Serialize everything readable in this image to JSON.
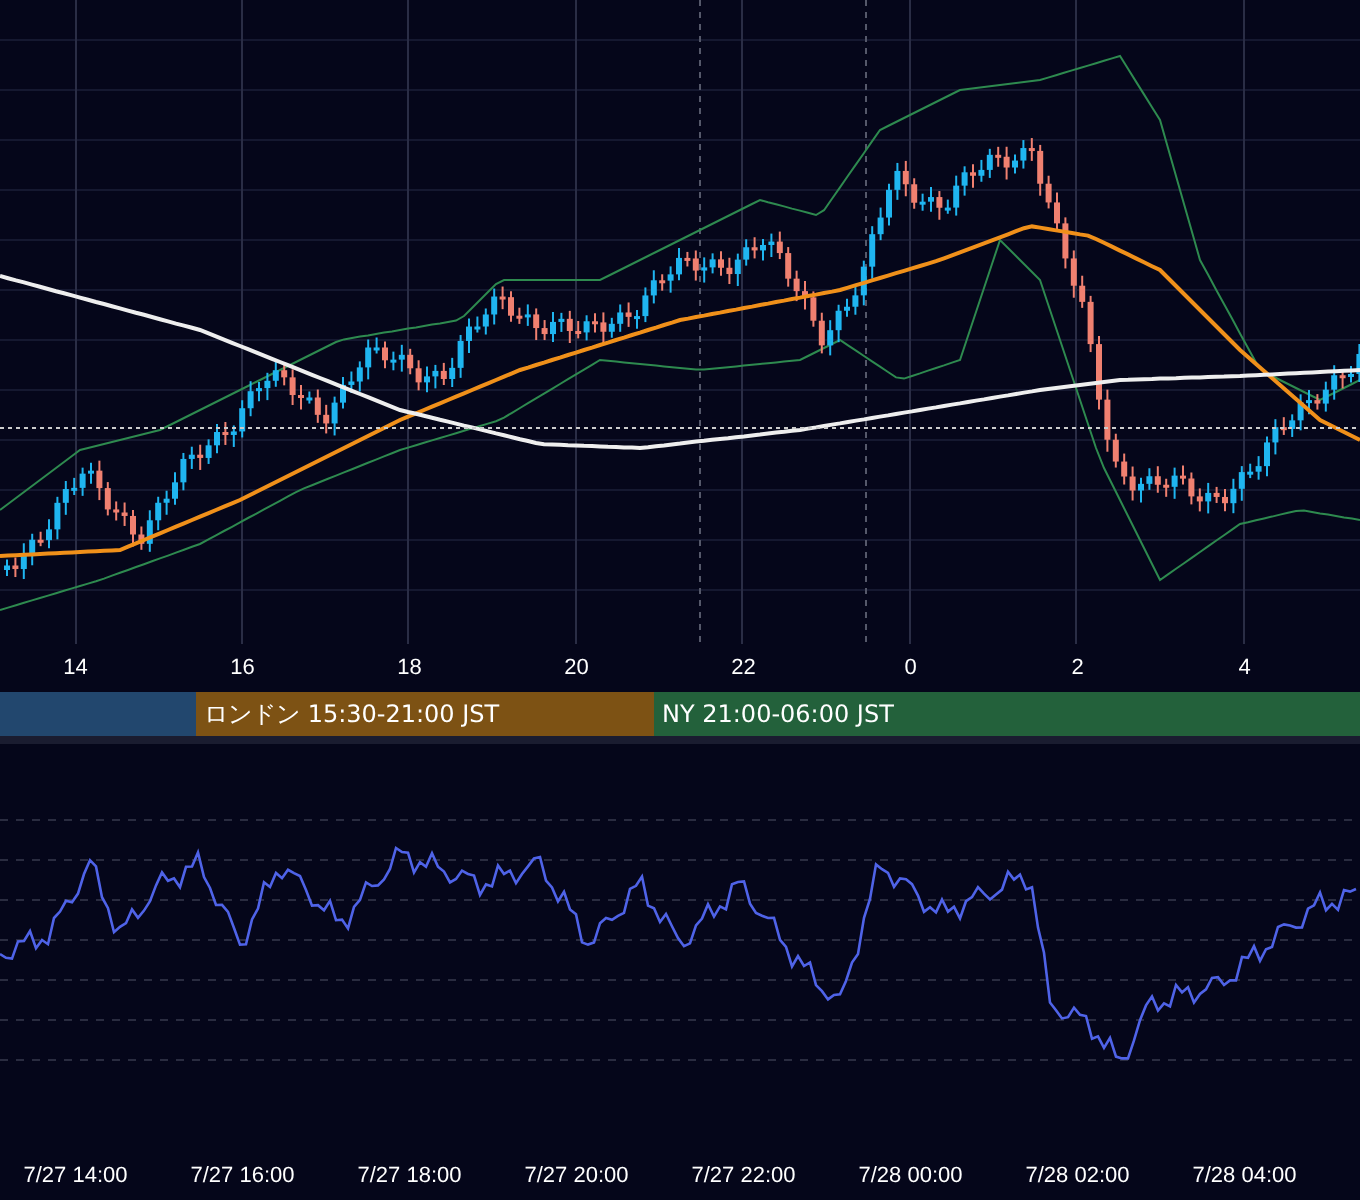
{
  "price_chart": {
    "kind": "picture",
    "x_axis": [
      "14",
      "16",
      "18",
      "20",
      "22",
      "0",
      "2",
      "4"
    ]
  },
  "sessions": [
    {
      "color": "#22476e"
    },
    {
      "label": "ロンドン 15:30-21:00 JST",
      "color": "#7d5214"
    },
    {
      "label": "NY 21:00-06:00 JST",
      "color": "#23613b"
    }
  ],
  "oscillator": {
    "kind": "picture",
    "x_axis": [
      "7/27 14:00",
      "7/27 16:00",
      "7/27 18:00",
      "7/27 20:00",
      "7/27 22:00",
      "7/28 00:00",
      "7/28 02:00",
      "7/28 04:00"
    ]
  }
}
